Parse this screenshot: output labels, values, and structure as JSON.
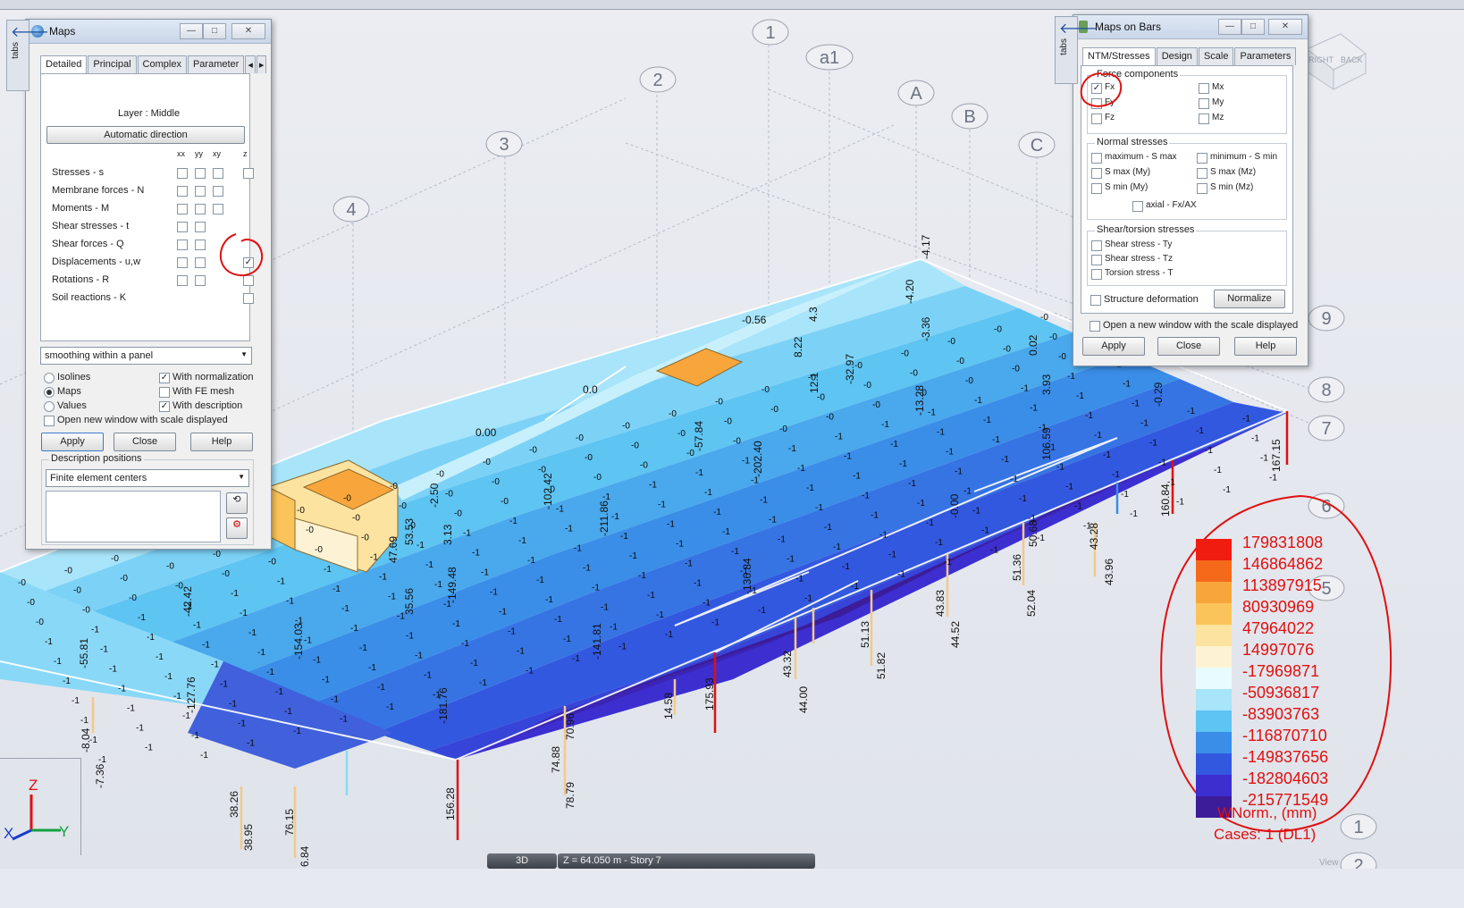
{
  "maps": {
    "title": "Maps",
    "side_tab": "tabs",
    "tabs": [
      "Detailed",
      "Principal",
      "Complex",
      "Parameter"
    ],
    "layer": "Layer : Middle",
    "auto_direction": "Automatic direction",
    "cols": [
      "xx",
      "yy",
      "xy",
      "z"
    ],
    "rows": [
      {
        "label": "Stresses - s",
        "cb": [
          false,
          false,
          false,
          false
        ],
        "has": [
          1,
          1,
          1,
          1
        ]
      },
      {
        "label": "Membrane forces - N",
        "cb": [
          false,
          false,
          false
        ],
        "has": [
          1,
          1,
          1,
          0
        ]
      },
      {
        "label": "Moments - M",
        "cb": [
          false,
          false,
          false
        ],
        "has": [
          1,
          1,
          1,
          0
        ]
      },
      {
        "label": "Shear stresses - t",
        "cb": [
          false,
          false
        ],
        "has": [
          1,
          1,
          0,
          0
        ]
      },
      {
        "label": "Shear forces - Q",
        "cb": [
          false,
          false
        ],
        "has": [
          1,
          1,
          0,
          0
        ]
      },
      {
        "label": "Displacements - u,w",
        "cb": [
          false,
          false,
          true
        ],
        "has": [
          1,
          1,
          0,
          1
        ]
      },
      {
        "label": "Rotations - R",
        "cb": [
          false,
          false,
          false
        ],
        "has": [
          1,
          1,
          0,
          1
        ]
      },
      {
        "label": "Soil reactions - K",
        "cb": [
          false
        ],
        "has": [
          0,
          0,
          0,
          1
        ]
      }
    ],
    "smoothing": "smoothing within a panel",
    "radios": [
      {
        "label": "Isolines",
        "on": false
      },
      {
        "label": "Maps",
        "on": true
      },
      {
        "label": "Values",
        "on": false
      }
    ],
    "checks": [
      {
        "label": "With normalization",
        "on": true
      },
      {
        "label": "With FE mesh",
        "on": false
      },
      {
        "label": "With description",
        "on": true
      }
    ],
    "open_new": "Open new window with scale displayed",
    "apply": "Apply",
    "close": "Close",
    "help": "Help",
    "desc_pos_label": "Description positions",
    "desc_pos": "Finite element centers"
  },
  "bars": {
    "title": "Maps on Bars",
    "side_tab": "tabs",
    "tabs": [
      "NTM/Stresses",
      "Design",
      "Scale",
      "Parameters"
    ],
    "force_group": "Force components",
    "forces": [
      {
        "label": "Fx",
        "on": true
      },
      {
        "label": "Mx",
        "on": false
      },
      {
        "label": "Fy",
        "on": false
      },
      {
        "label": "My",
        "on": false
      },
      {
        "label": "Fz",
        "on": false
      },
      {
        "label": "Mz",
        "on": false
      }
    ],
    "normal_group": "Normal stresses",
    "normals": [
      "maximum - S max",
      "minimum - S min",
      "S max (My)",
      "S max (Mz)",
      "S min (My)",
      "S min (Mz)",
      "axial - Fx/AX"
    ],
    "shear_group": "Shear/torsion stresses",
    "shears": [
      "Shear stress - Ty",
      "Shear stress - Tz",
      "Torsion stress - T"
    ],
    "structure_def": "Structure deformation",
    "normalize": "Normalize",
    "open_new": "Open a new window with the scale displayed",
    "apply": "Apply",
    "close": "Close",
    "help": "Help"
  },
  "legend": {
    "values": [
      "179831808",
      "146864862",
      "113897915",
      "80930969",
      "47964022",
      "14997076",
      "-17969871",
      "-50936817",
      "-83903763",
      "-116870710",
      "-149837656",
      "-182804603",
      "-215771549"
    ],
    "colors": [
      "#f01c10",
      "#f56a1a",
      "#f8a63c",
      "#fbc45a",
      "#fde3a0",
      "#fdf3d4",
      "#e8fbff",
      "#a8e4fa",
      "#5ec4f2",
      "#3a8ee8",
      "#3358e0",
      "#3d2ed0",
      "#3c1c98"
    ],
    "unit": "WNorm., (mm)",
    "cases": "Cases: 1 (DL1)"
  },
  "status": {
    "view": "3D",
    "z": "Z = 64.050 m - Story 7",
    "view_label": "View"
  },
  "cube": {
    "right": "RIGHT",
    "back": "BACK"
  },
  "axes": {
    "z": "Z",
    "y": "Y",
    "x": "X"
  },
  "grid_labels": [
    {
      "t": "1"
    },
    {
      "t": "a1"
    },
    {
      "t": "2"
    },
    {
      "t": "A"
    },
    {
      "t": "B"
    },
    {
      "t": "C"
    },
    {
      "t": "3"
    },
    {
      "t": "4"
    },
    {
      "t": "9"
    },
    {
      "t": "8"
    },
    {
      "t": "7"
    },
    {
      "t": "6"
    },
    {
      "t": "5"
    },
    {
      "t": "1"
    },
    {
      "t": "2"
    }
  ],
  "value_labels": [
    "167.15",
    "160.84",
    "43.28",
    "43.96",
    "51.36",
    "52.04",
    "50.68",
    "43.83",
    "44.52",
    "51.13",
    "51.82",
    "43.32",
    "44.00",
    "175.93",
    "14.58",
    "74.88",
    "78.79",
    "70.96",
    "156.28",
    "38.26",
    "38.95",
    "76.15",
    "6.84",
    "-8.04",
    "-7.36",
    "-55.81",
    "-42.42",
    "-127.76",
    "-154.03",
    "-181.76",
    "-149.48",
    "-141.81",
    "-136.84",
    "-202.40",
    "-211.86",
    "-102.42",
    "-57.84",
    "-32.97",
    "-13.28",
    "-3.36",
    "-0.56",
    "0.0",
    "0.00",
    "0.02",
    "3.93",
    "-0.29",
    "106.59",
    "-4.17",
    "-4.20",
    "4.3",
    "8.22",
    "12.1",
    "35.56",
    "47.69",
    "53.53",
    "-2.50",
    "3.13",
    "-0.00",
    "1",
    "-1",
    "-0",
    "0.0"
  ]
}
